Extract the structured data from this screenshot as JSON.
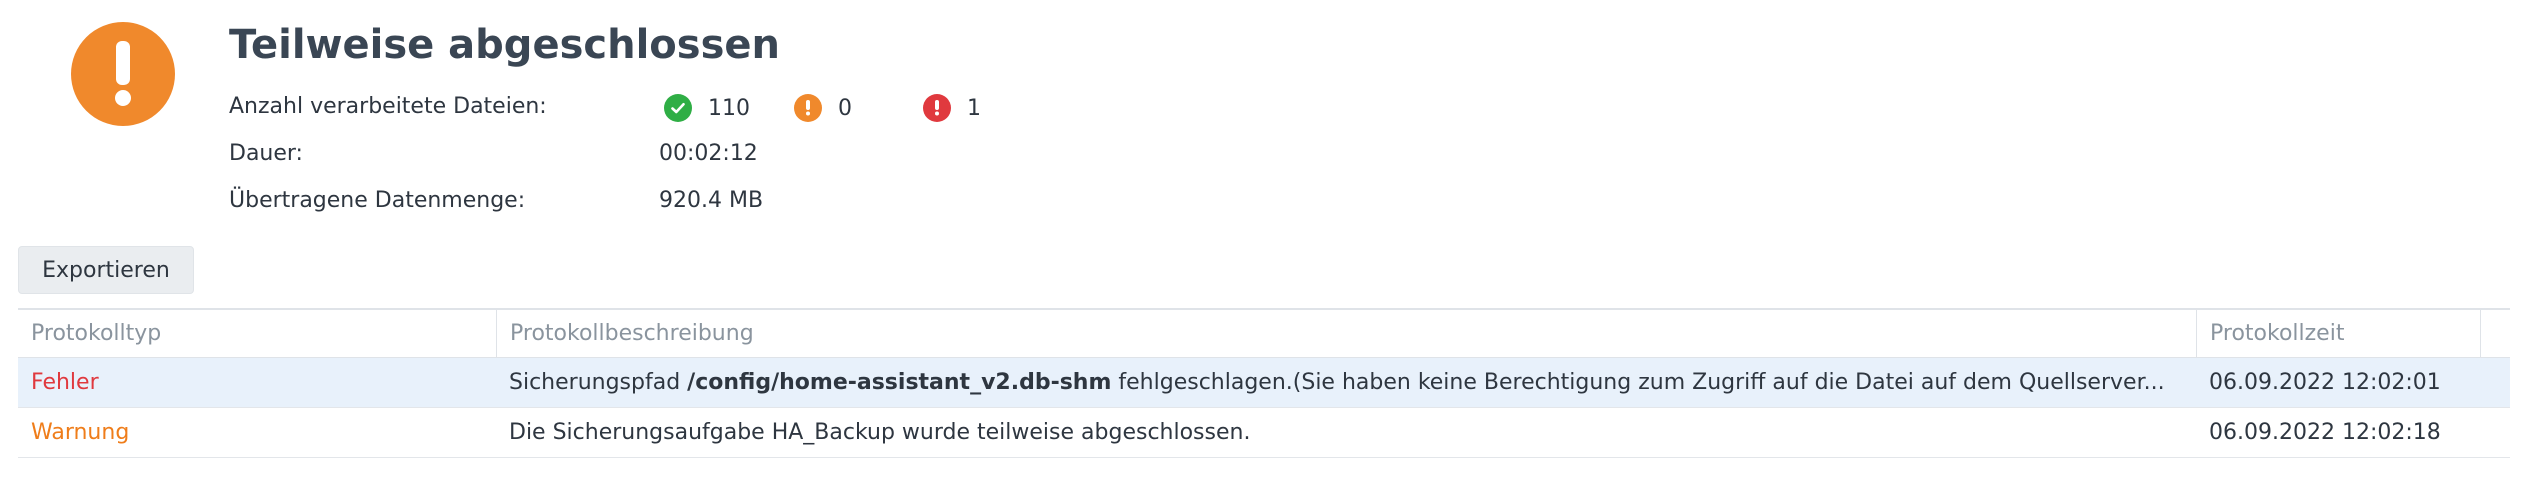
{
  "header": {
    "title": "Teilweise abgeschlossen",
    "status_icon": "warning-exclamation-icon",
    "status_color": "#f0892c"
  },
  "summary": {
    "files_label": "Anzahl verarbeitete Dateien:",
    "success_count": "110",
    "warning_count": "0",
    "error_count": "1",
    "duration_label": "Dauer:",
    "duration_value": "00:02:12",
    "transferred_label": "Übertragene Datenmenge:",
    "transferred_value": "920.4 MB",
    "colors": {
      "success": "#2fae45",
      "warning": "#f0892c",
      "error": "#e0393e"
    }
  },
  "toolbar": {
    "export_label": "Exportieren"
  },
  "log_table": {
    "columns": [
      "Protokolltyp",
      "Protokollbeschreibung",
      "Protokollzeit"
    ],
    "rows": [
      {
        "type": "Fehler",
        "desc_prefix": "Sicherungspfad ",
        "desc_bold": "/config/home-assistant_v2.db-shm",
        "desc_suffix": " fehlgeschlagen.(Sie haben keine Berechtigung zum Zugriff auf die Datei auf dem Quellserver...",
        "time": "06.09.2022 12:02:01",
        "selected": true
      },
      {
        "type": "Warnung",
        "desc_prefix": "Die Sicherungsaufgabe HA_Backup wurde teilweise abgeschlossen.",
        "desc_bold": "",
        "desc_suffix": "",
        "time": "06.09.2022 12:02:18",
        "selected": false
      }
    ]
  }
}
